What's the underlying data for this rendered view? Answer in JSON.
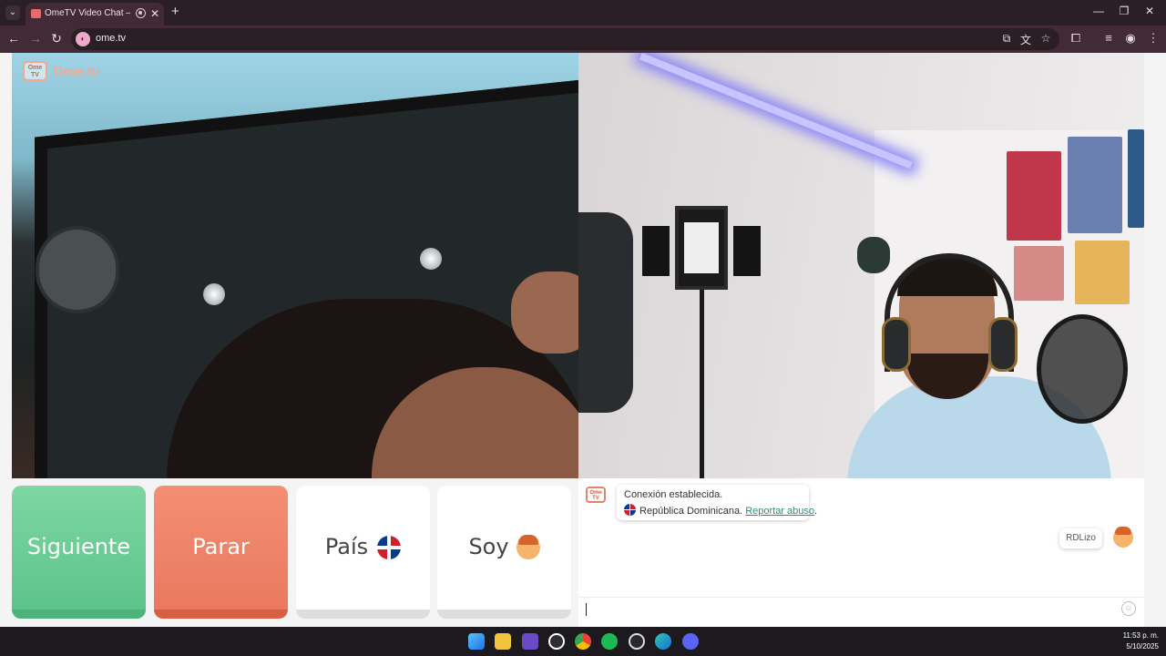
{
  "browser": {
    "tab_title": "OmeTV Video Chat — OmeTV",
    "tab_close": "✕",
    "new_tab": "+",
    "url": "ome.tv",
    "window_controls": {
      "minimize": "—",
      "restore": "❐",
      "close": "✕"
    }
  },
  "brand": {
    "logo_badge": "Ome TV",
    "logo_text": "Ome.tv"
  },
  "buttons": {
    "next": "Siguiente",
    "stop": "Parar",
    "country": "País",
    "gender": "Soy"
  },
  "chat": {
    "system_line1": "Conexión establecida.",
    "country_name": "República Dominicana.",
    "report_link": "Reportar abuso",
    "report_suffix": ".",
    "user_message": "RDLizo",
    "input_value": ""
  },
  "taskbar": {
    "time": "11:53 p. m.",
    "date": "5/10/2025",
    "icons": [
      "windows-icon",
      "file-explorer-icon",
      "camera-app-icon",
      "xbox-icon",
      "chrome-icon",
      "spotify-icon",
      "steam-icon",
      "edge-icon",
      "discord-icon"
    ]
  },
  "colors": {
    "next_button": "#6fcf97",
    "stop_button": "#ef8468",
    "brand_orange": "#f3aa92",
    "link": "#2f8a7e"
  }
}
